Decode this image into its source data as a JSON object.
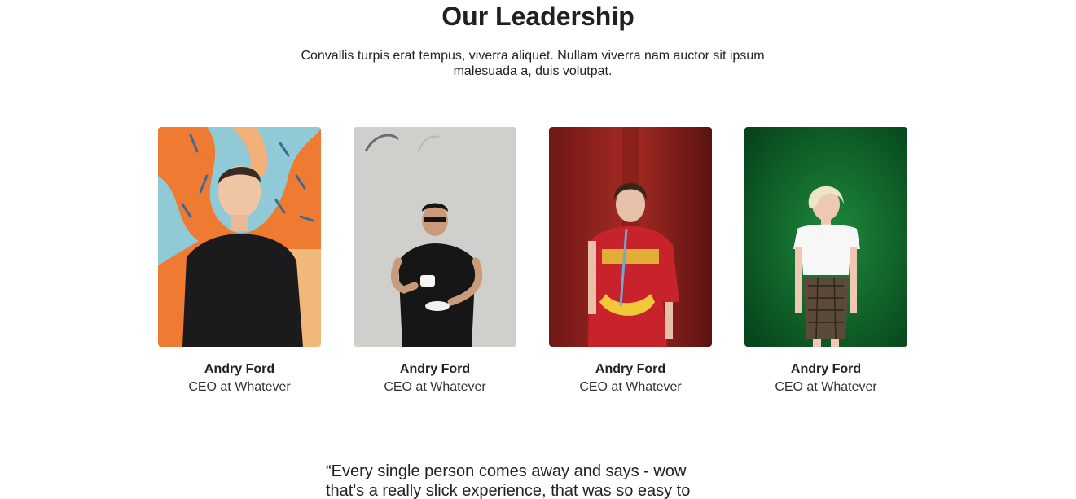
{
  "section": {
    "title": "Our Leadership",
    "subtitle": "Convallis turpis erat tempus, viverra aliquet. Nullam viverra nam auctor sit ipsum malesuada a, duis volutpat."
  },
  "team": [
    {
      "name": "Andry Ford",
      "role": "CEO at Whatever",
      "photo": "portrait-man-orange-mural"
    },
    {
      "name": "Andry Ford",
      "role": "CEO at Whatever",
      "photo": "portrait-man-coffee-concrete"
    },
    {
      "name": "Andry Ford",
      "role": "CEO at Whatever",
      "photo": "portrait-woman-red-wall"
    },
    {
      "name": "Andry Ford",
      "role": "CEO at Whatever",
      "photo": "portrait-woman-green-wall"
    }
  ],
  "testimonial": {
    "text": "“Every single person comes away and says - wow that's a really slick experience, that was so easy to"
  },
  "colors": {
    "heading": "#1f2024",
    "text": "#222222",
    "background": "#ffffff"
  }
}
